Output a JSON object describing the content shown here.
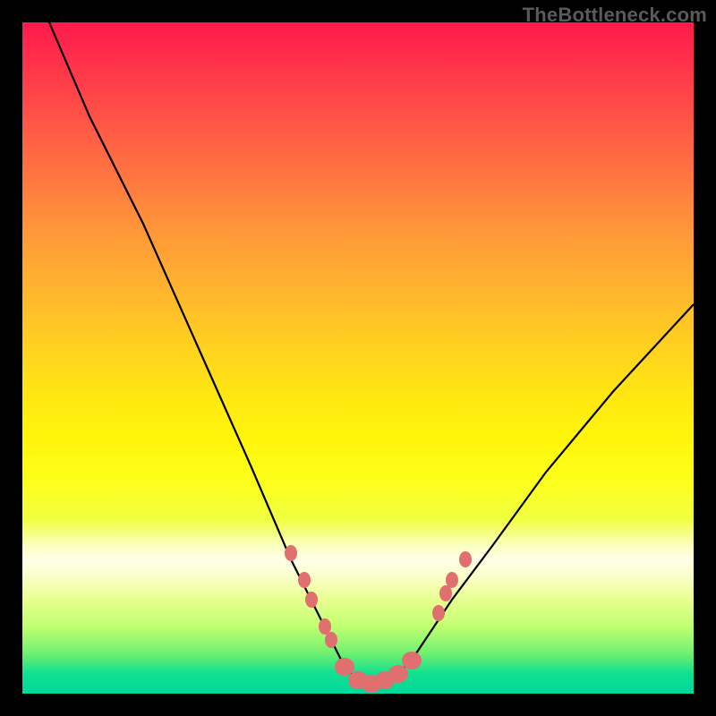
{
  "watermark": "TheBottleneck.com",
  "chart_data": {
    "type": "line",
    "title": "",
    "xlabel": "",
    "ylabel": "",
    "xlim": [
      0,
      100
    ],
    "ylim": [
      0,
      100
    ],
    "series": [
      {
        "name": "curve",
        "x": [
          4,
          10,
          18,
          26,
          34,
          40,
          45,
          48,
          50,
          52,
          54,
          56,
          58,
          60,
          64,
          70,
          78,
          88,
          100
        ],
        "y": [
          100,
          86,
          70,
          52,
          34,
          20,
          10,
          4,
          2,
          1,
          2,
          3,
          5,
          8,
          14,
          22,
          33,
          45,
          58
        ]
      }
    ],
    "markers": {
      "left_cluster": [
        {
          "x": 40,
          "y": 21
        },
        {
          "x": 42,
          "y": 17
        },
        {
          "x": 43,
          "y": 14
        },
        {
          "x": 45,
          "y": 10
        },
        {
          "x": 46,
          "y": 8
        }
      ],
      "valley": [
        {
          "x": 48,
          "y": 4
        },
        {
          "x": 50,
          "y": 2
        },
        {
          "x": 52,
          "y": 1.5
        },
        {
          "x": 54,
          "y": 2
        },
        {
          "x": 56,
          "y": 3
        },
        {
          "x": 58,
          "y": 5
        }
      ],
      "right_cluster": [
        {
          "x": 62,
          "y": 12
        },
        {
          "x": 63,
          "y": 15
        },
        {
          "x": 64,
          "y": 17
        },
        {
          "x": 66,
          "y": 20
        }
      ]
    },
    "colors": {
      "curve": "#000000",
      "marker": "#e06f6f",
      "gradient_top": "#ff1a4d",
      "gradient_mid": "#ffe812",
      "gradient_bottom": "#00d89c"
    }
  }
}
